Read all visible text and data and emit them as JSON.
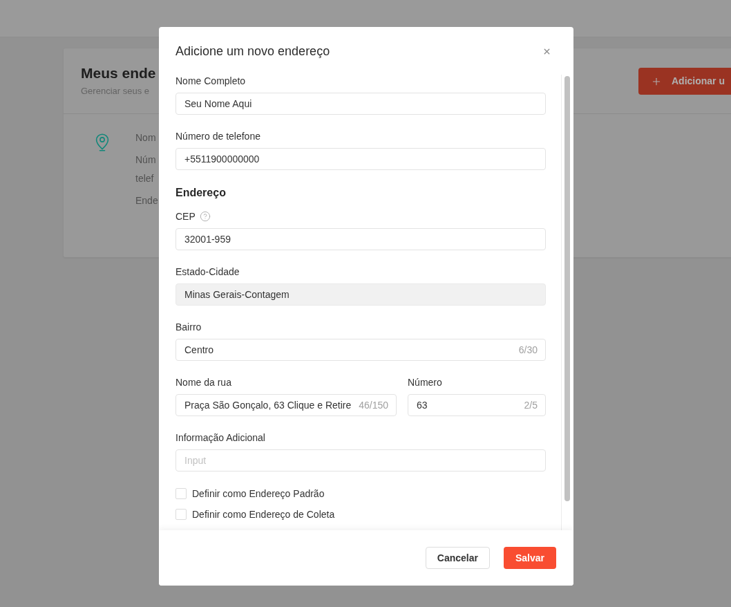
{
  "card": {
    "title": "Meus ende",
    "subtitle": "Gerenciar seus e",
    "add_button": "Adicionar u",
    "detail_lines": [
      "Nom",
      "Núm",
      "telef",
      "Ende"
    ]
  },
  "dialog": {
    "title": "Adicione um novo endereço",
    "items": [
      {
        "kind": "field",
        "label": "Nome Completo",
        "value": "Seu Nome Aqui",
        "disabled": false
      },
      {
        "kind": "field",
        "label": "Número de telefone",
        "value": "+5511900000000",
        "disabled": false
      },
      {
        "kind": "heading",
        "label": "Endereço"
      },
      {
        "kind": "field",
        "label": "CEP",
        "help": true,
        "value": "32001-959",
        "disabled": false
      },
      {
        "kind": "field",
        "label": "Estado-Cidade",
        "value": "Minas Gerais-Contagem",
        "disabled": true
      },
      {
        "kind": "field",
        "label": "Bairro",
        "value": "Centro",
        "counter": "6/30",
        "disabled": false
      },
      {
        "kind": "pair",
        "fields": [
          {
            "label": "Nome da rua",
            "value": "Praça São Gonçalo, 63 Clique e Retire",
            "counter": "46/150",
            "disabled": false
          },
          {
            "label": "Número",
            "value": "63",
            "counter": "2/5",
            "disabled": false
          }
        ]
      },
      {
        "kind": "field",
        "label": "Informação Adicional",
        "placeholder": "Input",
        "disabled": false
      }
    ],
    "checkboxes": [
      {
        "label": "Definir como Endereço Padrão",
        "checked": false
      },
      {
        "label": "Definir como Endereço de Coleta",
        "checked": false
      }
    ],
    "buttons": [
      {
        "label": "Cancelar",
        "kind": "secondary"
      },
      {
        "label": "Salvar",
        "kind": "primary"
      }
    ]
  }
}
